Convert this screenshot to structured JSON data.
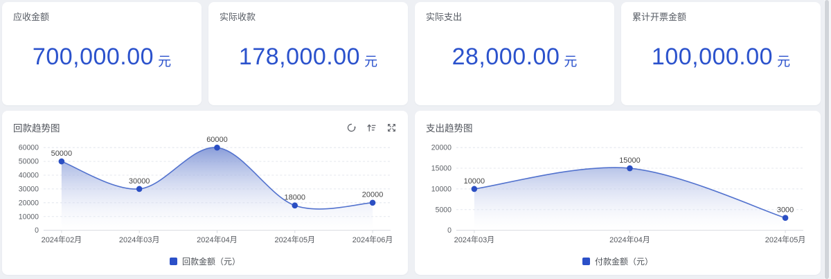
{
  "page": {
    "background": "#eef0f4"
  },
  "colors": {
    "accent": "#2b52cc",
    "line": "#5272ce",
    "marker": "#2b4fc3",
    "legend_swatch": "#2b50c8",
    "area_top": "#8095d6",
    "area_bottom": "#ffffff",
    "grid": "#e4e7ee",
    "axis": "#d5d8de",
    "tick_label": "#5d6167",
    "x_label": "#55585e",
    "data_label": "#454545"
  },
  "stats": {
    "cards": [
      {
        "title": "应收金额",
        "value": "700,000.00",
        "unit": "元"
      },
      {
        "title": "实际收款",
        "value": "178,000.00",
        "unit": "元"
      },
      {
        "title": "实际支出",
        "value": "28,000.00",
        "unit": "元"
      },
      {
        "title": "累计开票金额",
        "value": "100,000.00",
        "unit": "元"
      }
    ]
  },
  "toolbar": {
    "icons": [
      {
        "name": "refresh-icon"
      },
      {
        "name": "sort-asc-icon"
      },
      {
        "name": "fullscreen-icon"
      }
    ]
  },
  "chart_data": [
    {
      "type": "area",
      "title": "回款趋势图",
      "categories": [
        "2024年02月",
        "2024年03月",
        "2024年04月",
        "2024年05月",
        "2024年06月"
      ],
      "series": [
        {
          "name": "回款金额（元）",
          "values": [
            50000,
            30000,
            60000,
            18000,
            20000
          ]
        }
      ],
      "ylim": [
        0,
        60000
      ],
      "ytick_step": 10000,
      "yticks": [
        0,
        10000,
        20000,
        30000,
        40000,
        50000,
        60000
      ],
      "smooth": true,
      "grid": "horizontal-dashed",
      "markers": true,
      "data_labels": true,
      "legend_position": "bottom"
    },
    {
      "type": "area",
      "title": "支出趋势图",
      "categories": [
        "2024年03月",
        "2024年04月",
        "2024年05月"
      ],
      "series": [
        {
          "name": "付款金额（元）",
          "values": [
            10000,
            15000,
            3000
          ]
        }
      ],
      "ylim": [
        0,
        20000
      ],
      "ytick_step": 5000,
      "yticks": [
        0,
        5000,
        10000,
        15000,
        20000
      ],
      "smooth": true,
      "grid": "horizontal-dashed",
      "markers": true,
      "data_labels": true,
      "legend_position": "bottom"
    }
  ]
}
